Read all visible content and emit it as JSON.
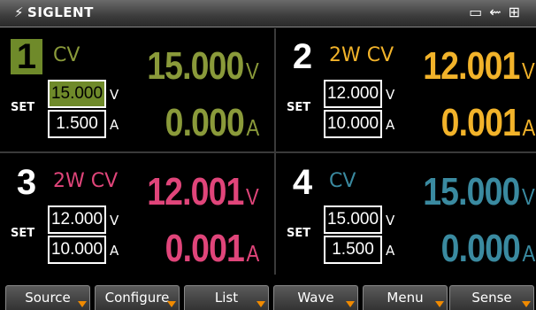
{
  "brand": {
    "logo": "siglent-logo-icon",
    "name": "SIGLENT"
  },
  "status_icons": [
    "save-icon",
    "usb-icon",
    "lan-icon"
  ],
  "colors": {
    "ch1": "#8a9a3a",
    "ch2": "#f2b32a",
    "ch3": "#e0457a",
    "ch4": "#3a8aa0",
    "accent": "#6f8a2a",
    "softkey_marker": "#f08a00"
  },
  "channels": [
    {
      "num": "1",
      "mode": "CV",
      "voltage": "15.000",
      "volt_unit": "V",
      "current": "0.000",
      "amp_unit": "A",
      "set_label": "SET",
      "set_voltage": "15.000",
      "set_current": "1.500",
      "set_v_unit": "V",
      "set_a_unit": "A"
    },
    {
      "num": "2",
      "mode": "2W CV",
      "voltage": "12.001",
      "volt_unit": "V",
      "current": "0.001",
      "amp_unit": "A",
      "set_label": "SET",
      "set_voltage": "12.000",
      "set_current": "10.000",
      "set_v_unit": "V",
      "set_a_unit": "A"
    },
    {
      "num": "3",
      "mode": "2W CV",
      "voltage": "12.001",
      "volt_unit": "V",
      "current": "0.001",
      "amp_unit": "A",
      "set_label": "SET",
      "set_voltage": "12.000",
      "set_current": "10.000",
      "set_v_unit": "V",
      "set_a_unit": "A"
    },
    {
      "num": "4",
      "mode": "CV",
      "voltage": "15.000",
      "volt_unit": "V",
      "current": "0.000",
      "amp_unit": "A",
      "set_label": "SET",
      "set_voltage": "15.000",
      "set_current": "1.500",
      "set_v_unit": "V",
      "set_a_unit": "A"
    }
  ],
  "softkeys": [
    "Source",
    "Configure",
    "List",
    "Wave",
    "Menu",
    "Sense"
  ]
}
